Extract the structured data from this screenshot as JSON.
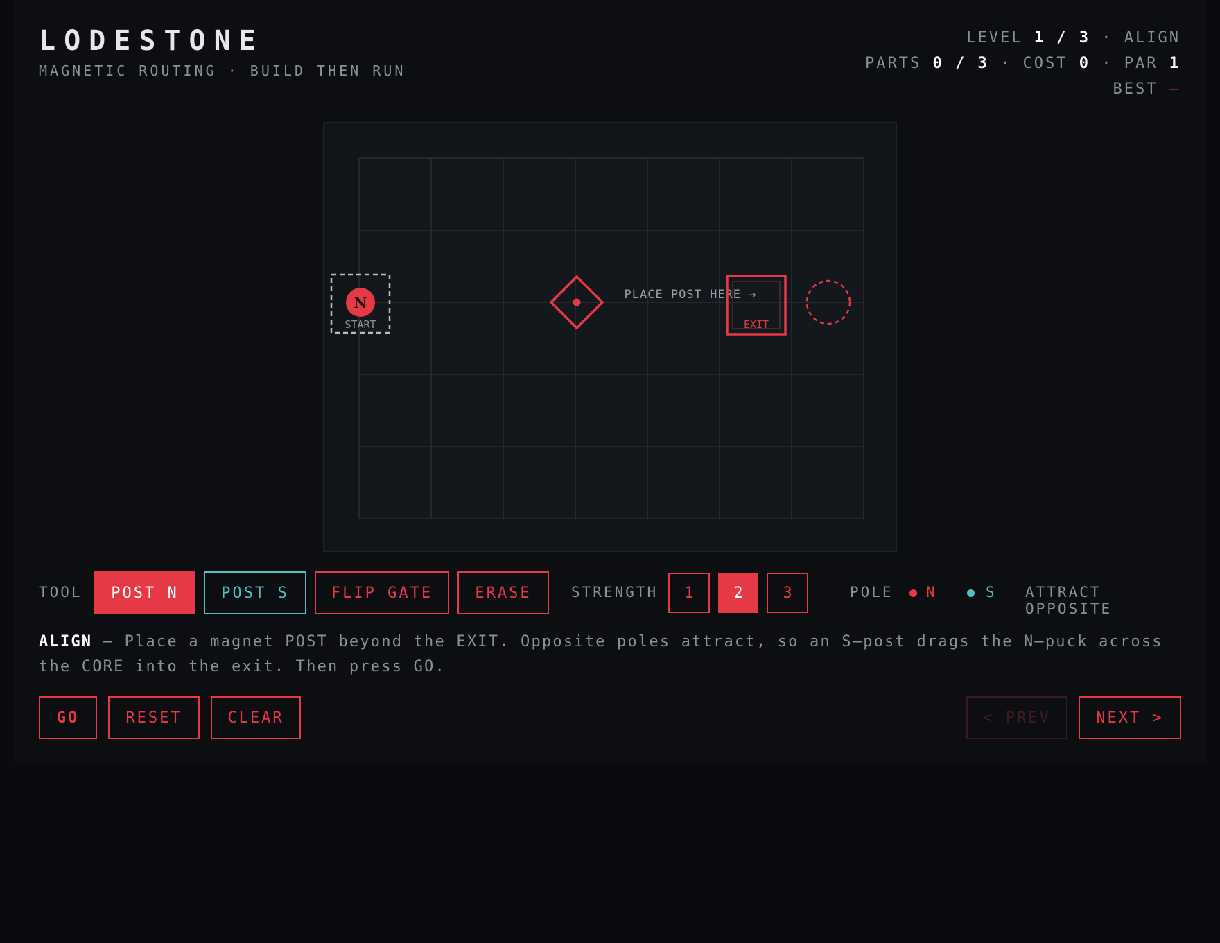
{
  "header": {
    "title": "LODESTONE",
    "subtitle": "MAGNETIC ROUTING · BUILD THEN RUN"
  },
  "stats": {
    "level_label": "LEVEL",
    "level": "1 / 3",
    "level_name": "ALIGN",
    "parts_label": "PARTS",
    "parts": "0 / 3",
    "cost_label": "COST",
    "cost": "0",
    "par_label": "PAR",
    "par": "1",
    "best_label": "BEST",
    "best": "—",
    "separator": "·"
  },
  "board": {
    "cols": 7,
    "rows": 5,
    "hint": "PLACE POST HERE →",
    "start_label": "START",
    "exit_label": "EXIT",
    "puck_label": "N",
    "start": {
      "col": 0,
      "row": 2
    },
    "core": {
      "col": 3,
      "row": 2
    },
    "exit": {
      "col": 5,
      "row": 2
    },
    "target": {
      "col": 6,
      "row": 2
    }
  },
  "toolbar": {
    "tool_label": "TOOL",
    "tools": [
      {
        "label": "POST N",
        "state": "active"
      },
      {
        "label": "POST S",
        "state": "teal"
      },
      {
        "label": "FLIP GATE",
        "state": "normal"
      },
      {
        "label": "ERASE",
        "state": "normal"
      }
    ],
    "strength_label": "STRENGTH",
    "strengths": [
      "1",
      "2",
      "3"
    ],
    "strength_selected": "2",
    "pole_label": "POLE",
    "pole_n": "N",
    "pole_s": "S",
    "attract_label": "ATTRACT OPPOSITE"
  },
  "description": {
    "level_name": "ALIGN",
    "text": " — Place a magnet POST beyond the EXIT. Opposite poles attract, so an S–post drags the N–puck across the CORE into the exit. Then press GO."
  },
  "actions": {
    "go": "GO",
    "reset": "RESET",
    "clear": "CLEAR",
    "prev": "< PREV",
    "next": "NEXT >"
  },
  "colors": {
    "accent": "#e63946",
    "teal": "#4ec0c3",
    "background": "#0a0b0e",
    "board": "#121518"
  }
}
